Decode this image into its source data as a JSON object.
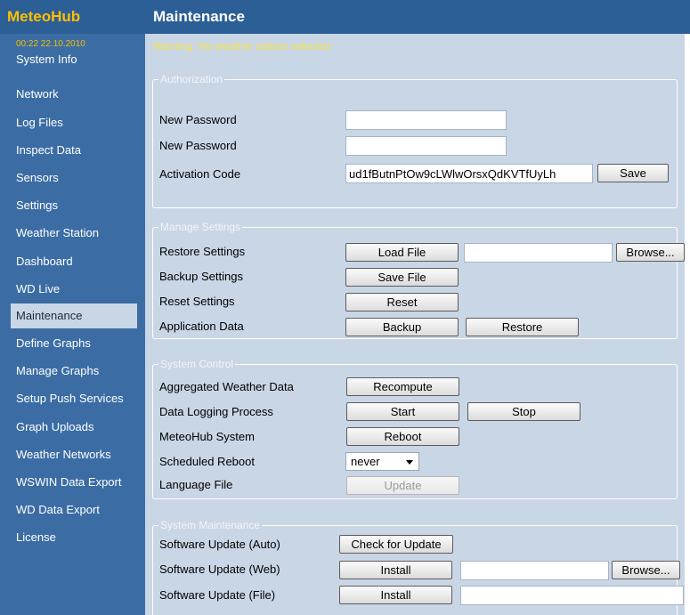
{
  "app": {
    "name": "MeteoHub",
    "page_title": "Maintenance"
  },
  "sidebar": {
    "clock": "00:22  22.10.2010",
    "items": [
      {
        "label": "System Info"
      },
      {
        "label": "Network"
      },
      {
        "label": "Log Files"
      },
      {
        "label": "Inspect Data"
      },
      {
        "label": "Sensors"
      },
      {
        "label": "Settings"
      },
      {
        "label": "Weather Station"
      },
      {
        "label": "Dashboard"
      },
      {
        "label": "WD Live"
      },
      {
        "label": "Maintenance",
        "active": true
      },
      {
        "label": "Define Graphs"
      },
      {
        "label": "Manage Graphs"
      },
      {
        "label": "Setup Push Services"
      },
      {
        "label": "Graph Uploads"
      },
      {
        "label": "Weather Networks"
      },
      {
        "label": "WSWIN Data Export"
      },
      {
        "label": "WD Data Export"
      },
      {
        "label": "License"
      }
    ]
  },
  "main": {
    "warning": "Warning: No weather station selected",
    "authorization": {
      "legend": "Authorization",
      "new_password_label_1": "New Password",
      "new_password_value_1": "",
      "new_password_label_2": "New Password",
      "new_password_value_2": "",
      "activation_code_label": "Activation Code",
      "activation_code_value": "ud1fButnPtOw9cLWlwOrsxQdKVTfUyLh",
      "save_label": "Save"
    },
    "manage_settings": {
      "legend": "Manage Settings",
      "restore_label": "Restore Settings",
      "load_file_button": "Load File",
      "restore_file_value": "",
      "browse_button": "Browse...",
      "backup_label": "Backup Settings",
      "save_file_button": "Save File",
      "reset_label": "Reset Settings",
      "reset_button": "Reset",
      "app_data_label": "Application Data",
      "backup_button": "Backup",
      "restore_button": "Restore"
    },
    "system_control": {
      "legend": "System Control",
      "aggregated_label": "Aggregated Weather Data",
      "recompute_button": "Recompute",
      "logging_label": "Data Logging Process",
      "start_button": "Start",
      "stop_button": "Stop",
      "system_label": "MeteoHub System",
      "reboot_button": "Reboot",
      "scheduled_label": "Scheduled Reboot",
      "scheduled_value": "never",
      "language_label": "Language File",
      "update_button": "Update"
    },
    "system_maintenance": {
      "legend": "System Maintenance",
      "auto_label": "Software Update (Auto)",
      "check_button": "Check for Update",
      "web_label": "Software Update (Web)",
      "install_web_button": "Install",
      "web_file_value": "",
      "browse_button": "Browse...",
      "file_label": "Software Update (File)",
      "install_file_button": "Install",
      "file_value": ""
    }
  }
}
